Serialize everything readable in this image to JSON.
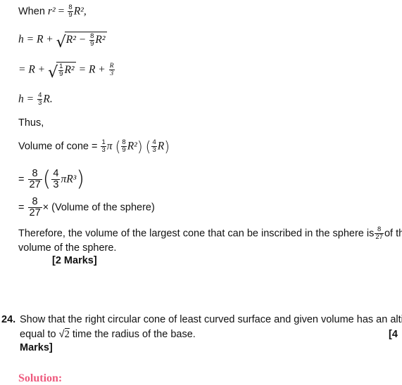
{
  "content": {
    "when_text": "When",
    "when_expr": {
      "lhs": "r²",
      "eq": "=",
      "frac": [
        "8",
        "9"
      ],
      "rhs": "R²,",
      "tail": ""
    },
    "h_line1": {
      "lhs": "h = R +",
      "radicand_a": "R² −",
      "frac": [
        "8",
        "9"
      ],
      "radicand_b": "R²"
    },
    "h_line2": {
      "lhs": "= R +",
      "frac": [
        "1",
        "9"
      ],
      "radicand_b": "R²",
      "mid": "= R +",
      "frac2": [
        "R",
        "3"
      ]
    },
    "h_line3": {
      "lhs": "h =",
      "frac": [
        "4",
        "3"
      ],
      "rhs": "R."
    },
    "thus": "Thus,",
    "volume_label": "Volume of cone =",
    "volume_expr": {
      "f1": [
        "1",
        "3"
      ],
      "pi": "π",
      "f2": [
        "8",
        "9"
      ],
      "r2": "R²",
      "f3": [
        "4",
        "3"
      ],
      "r": "R"
    },
    "step2": {
      "eq": "=",
      "f1": [
        "8",
        "27"
      ],
      "f2": [
        "4",
        "3"
      ],
      "tail": "πR³"
    },
    "step3": {
      "eq": "=",
      "f1": [
        "8",
        "27"
      ],
      "tail": "× (Volume of the sphere)"
    },
    "conclusion_a": "Therefore, the volume of the largest cone that can be inscribed in the sphere is",
    "conclusion_frac": [
      "8",
      "27"
    ],
    "conclusion_b": "of the",
    "conclusion_line2": "volume of the sphere.",
    "marks_prev": "[2 Marks]",
    "question": {
      "number": "24.",
      "text_line1": "Show that the right circular cone of least curved surface and given volume has an altitude",
      "text_line2_a": "equal to",
      "sqrt_value": "2",
      "text_line2_b": "time the radius of the base.",
      "marks_part1": "[4",
      "marks_part2": "Marks]"
    },
    "solution_label": "Solution:"
  }
}
